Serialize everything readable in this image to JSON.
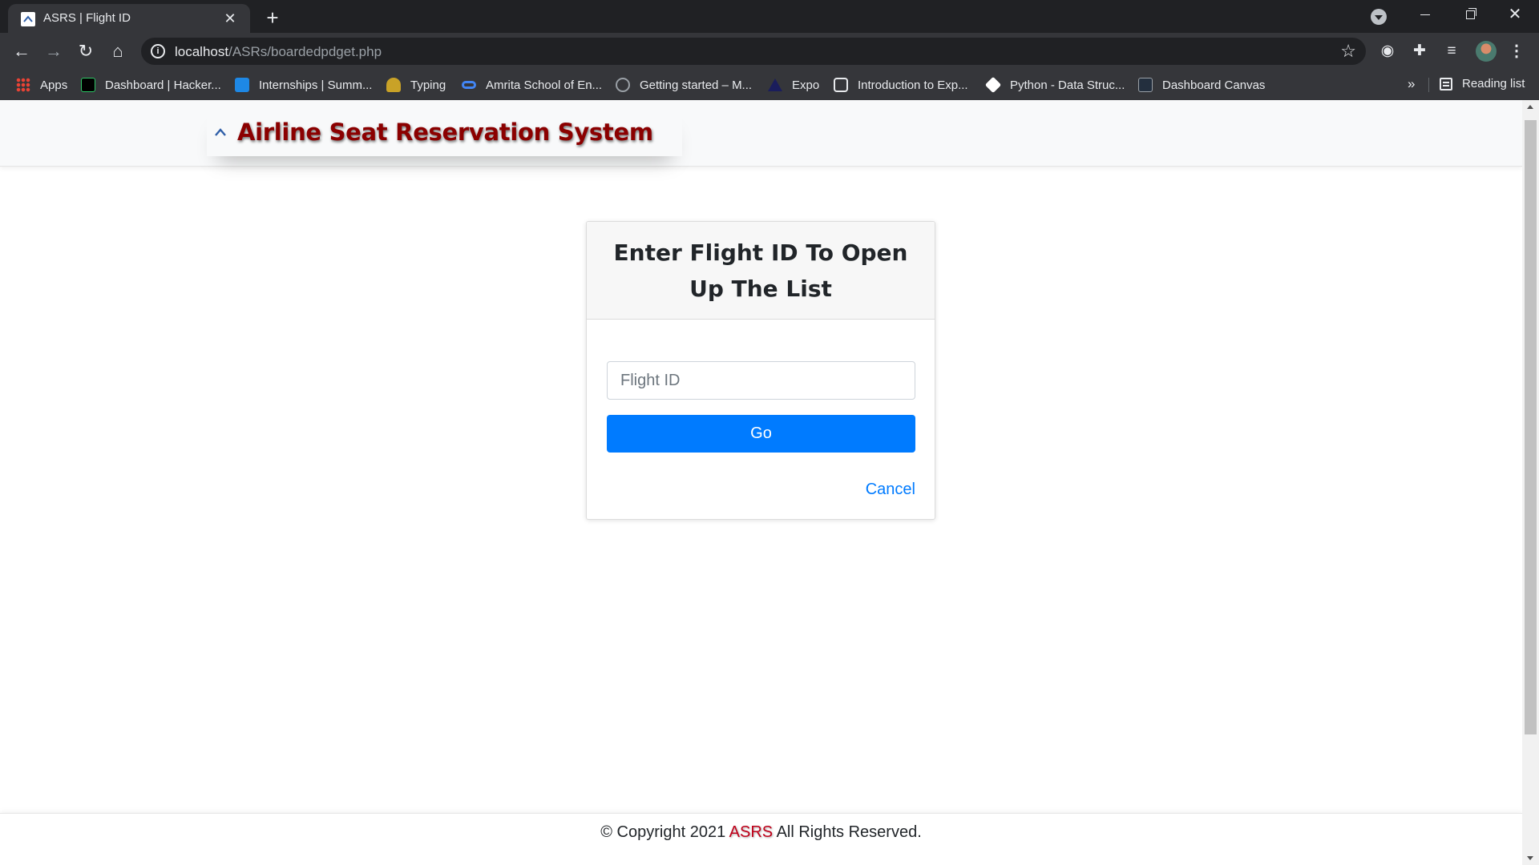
{
  "browser": {
    "tab_title": "ASRS | Flight ID",
    "tab_close": "✕",
    "new_tab": "+",
    "url_host": "localhost",
    "url_path": "/ASRs/boardedpdget.php",
    "bookmarks": [
      {
        "label": "Apps",
        "icon": "apps-grid-icon"
      },
      {
        "label": "Dashboard | Hacker...",
        "icon": "hackerrank-icon"
      },
      {
        "label": "Internships | Summ...",
        "icon": "internshala-icon"
      },
      {
        "label": "Typing",
        "icon": "typing-icon"
      },
      {
        "label": "Amrita School of En...",
        "icon": "amrita-icon"
      },
      {
        "label": "Getting started – M...",
        "icon": "globe-icon"
      },
      {
        "label": "Expo",
        "icon": "expo-icon"
      },
      {
        "label": "Introduction to Exp...",
        "icon": "intro-icon"
      },
      {
        "label": "Python - Data Struc...",
        "icon": "python-icon"
      },
      {
        "label": "Dashboard Canvas",
        "icon": "aws-icon"
      }
    ],
    "bookmarks_overflow": "»",
    "reading_list": "Reading list"
  },
  "site": {
    "brand": "Airline Seat Reservation System"
  },
  "form": {
    "title": "Enter Flight ID To Open Up The List",
    "input_placeholder": "Flight ID",
    "input_value": "",
    "submit_label": "Go",
    "cancel_label": "Cancel"
  },
  "footer": {
    "prefix": "© Copyright 2021",
    "brand": "ASRS",
    "suffix": "All Rights Reserved."
  },
  "colors": {
    "primary": "#007bff",
    "brand_red": "#8b0000",
    "chrome_dark": "#202124",
    "chrome_toolbar": "#35363a"
  }
}
